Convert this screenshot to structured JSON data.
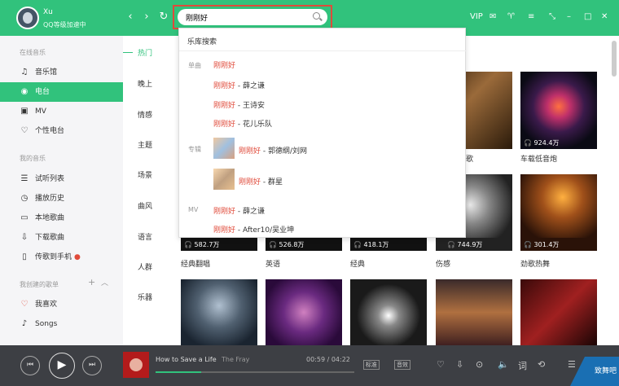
{
  "user": {
    "name": "Xu",
    "level_text": "QQ等级加速中"
  },
  "search": {
    "value": "刚刚好"
  },
  "topbar": {
    "vip": "VIP"
  },
  "sidebar": {
    "sections": [
      {
        "title": "在线音乐",
        "items": [
          "音乐馆",
          "电台",
          "MV",
          "个性电台"
        ]
      },
      {
        "title": "我的音乐",
        "items": [
          "试听列表",
          "播放历史",
          "本地歌曲",
          "下载歌曲",
          "传歌到手机"
        ]
      },
      {
        "title": "我创建的歌单",
        "items": [
          "我喜欢",
          "Songs"
        ]
      }
    ]
  },
  "categories": [
    "热门",
    "晚上",
    "情感",
    "主题",
    "场景",
    "曲风",
    "语言",
    "人群",
    "乐器"
  ],
  "dropdown": {
    "header": "乐库搜索",
    "song_label": "单曲",
    "album_label": "专辑",
    "mv_label": "MV",
    "hl": "刚刚好",
    "songs": [
      "",
      "- 薛之谦",
      "- 王诗安",
      "- 花儿乐队"
    ],
    "albums": [
      "- 郭德纲/刘网",
      "- 群星"
    ],
    "mvs": [
      "- 薛之谦",
      "- After10/吴业坤"
    ]
  },
  "cards": {
    "row1": [
      {
        "play": "924.4万",
        "title": "车载低音炮"
      },
      {
        "play": "",
        "title": "歌"
      }
    ],
    "row2": [
      {
        "play": "582.7万",
        "title": "经典翻唱"
      },
      {
        "play": "526.8万",
        "title": "英语"
      },
      {
        "play": "418.1万",
        "title": "经典"
      },
      {
        "play": "744.9万",
        "title": "伤感"
      },
      {
        "play": "301.4万",
        "title": "劲歌热舞"
      }
    ]
  },
  "player": {
    "song": "How to Save a Life",
    "artist": "The Fray",
    "time": "00:59 / 04:22",
    "progress": 0.23,
    "quality": "标准",
    "effect": "音效",
    "lyric": "词"
  },
  "watermark": "致舞吧",
  "colors": {
    "accent": "#31c27c",
    "highlight": "#e04b3b"
  }
}
